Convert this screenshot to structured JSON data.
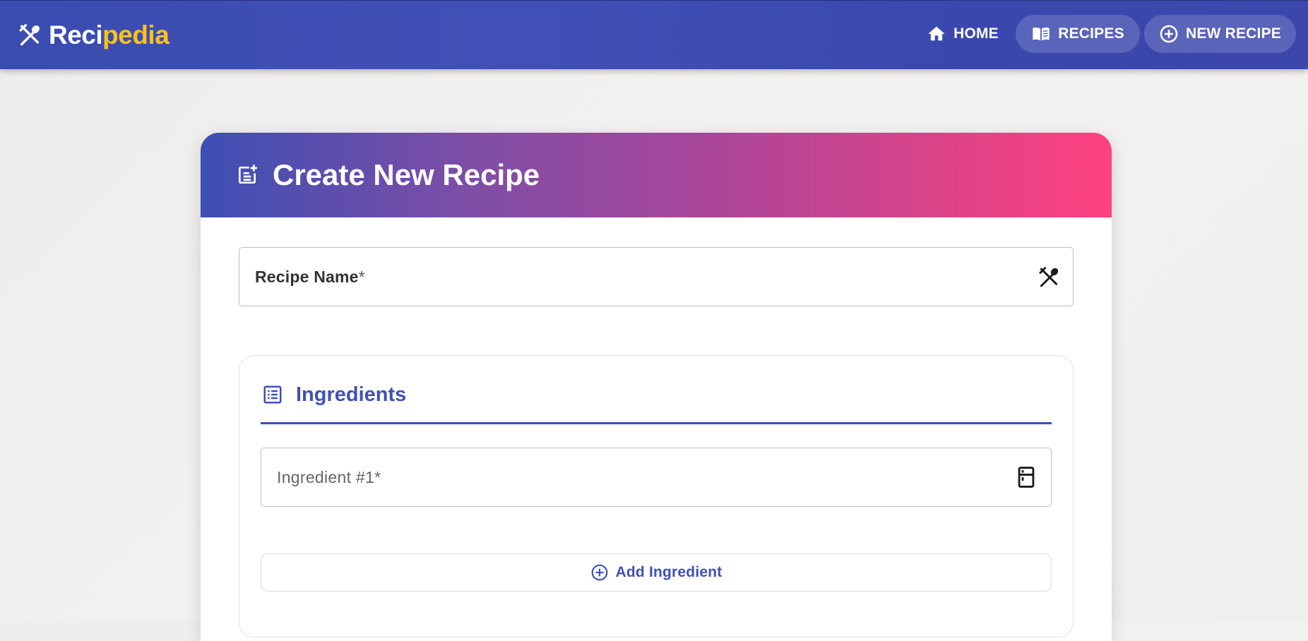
{
  "brand": {
    "part1": "Reci",
    "part2": "pedia",
    "icon": "fork-spoon-icon"
  },
  "nav": {
    "home": {
      "label": "HOME",
      "icon": "home-icon"
    },
    "recipes": {
      "label": "RECIPES",
      "icon": "book-icon"
    },
    "new_recipe": {
      "label": "NEW RECIPE",
      "icon": "plus-circle-icon"
    }
  },
  "form": {
    "title": "Create New Recipe",
    "title_icon": "post-add-icon",
    "recipe_name": {
      "label": "Recipe Name",
      "required_mark": "*",
      "value": "",
      "icon": "fork-spoon-icon"
    },
    "ingredients": {
      "title": "Ingredients",
      "icon": "list-icon",
      "items": [
        {
          "label": "Ingredient #1*",
          "value": "",
          "icon": "kitchen-icon"
        }
      ],
      "add_label": "Add Ingredient",
      "add_icon": "plus-circle-icon"
    }
  },
  "colors": {
    "primary": "#3f51b5",
    "brand_accent": "#ffc21a",
    "gradient_end": "#ff4180"
  }
}
